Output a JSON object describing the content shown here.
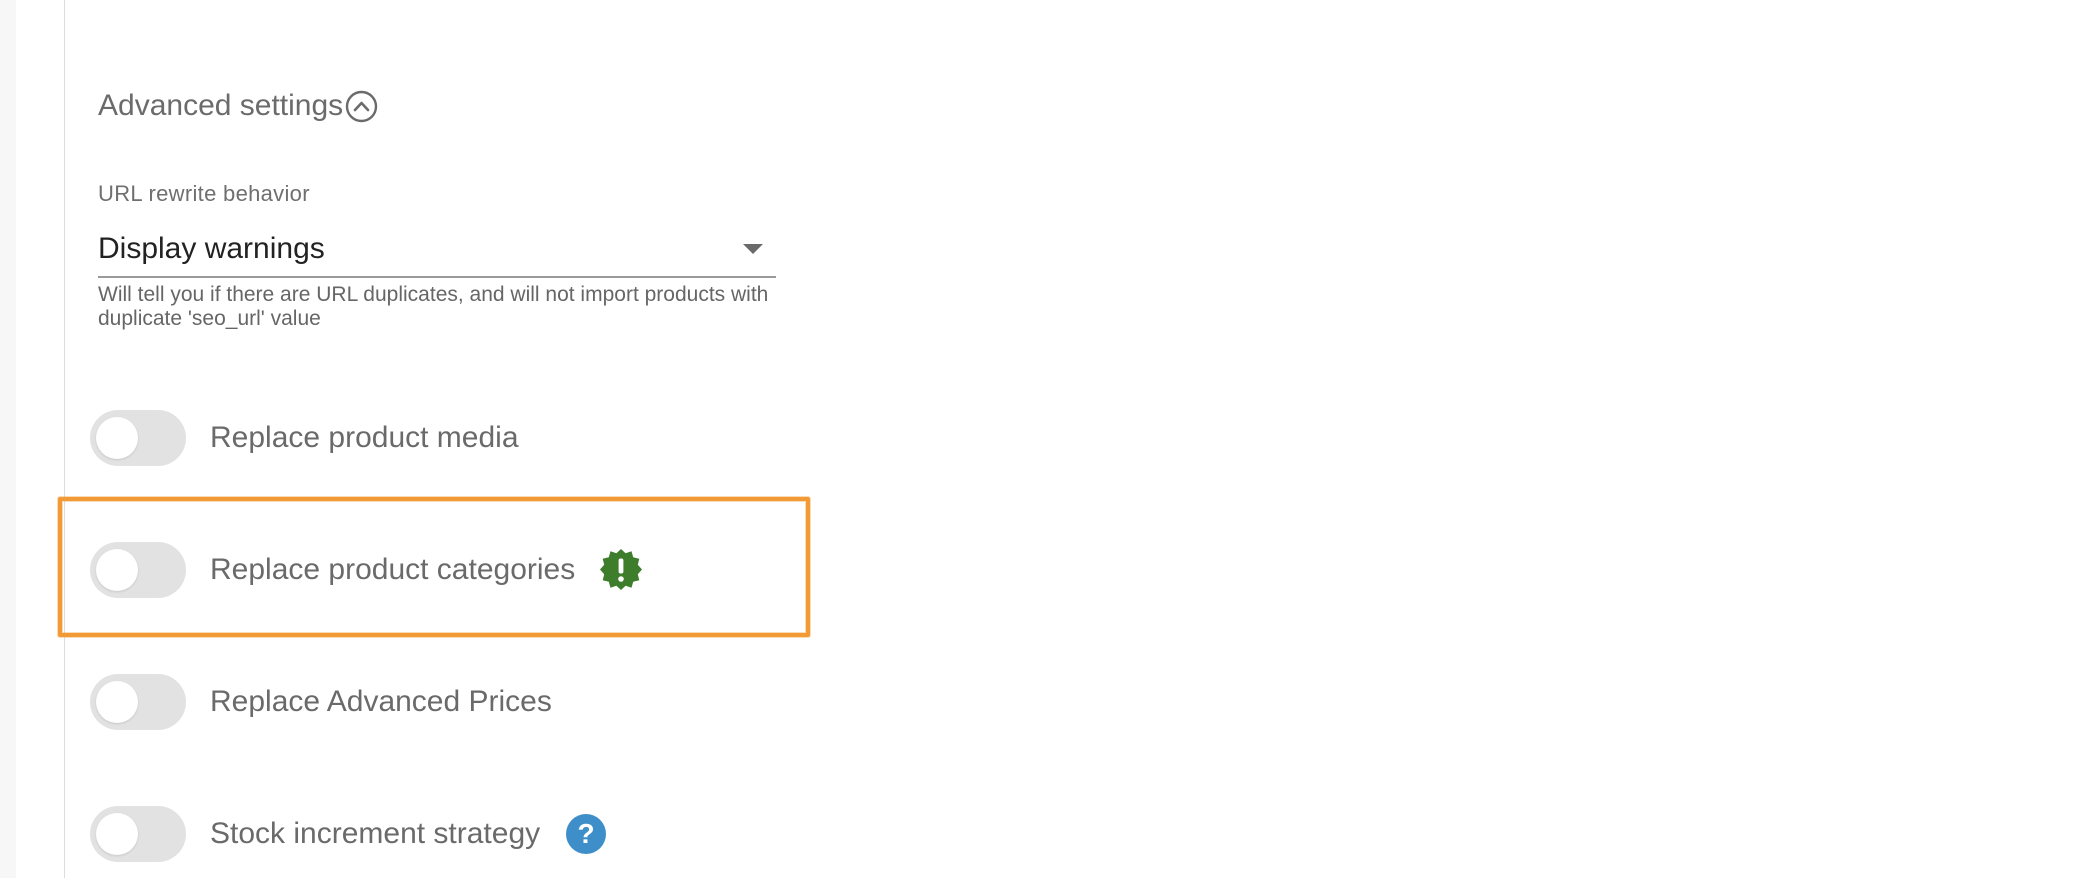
{
  "advanced_settings": {
    "title": "Advanced settings",
    "collapse_icon": "chevron-up-circle-icon"
  },
  "url_rewrite": {
    "label": "URL rewrite behavior",
    "selected_value": "Display warnings",
    "help_text": "Will tell you if there are URL duplicates, and will not import products with duplicate 'seo_url' value",
    "caret_icon": "chevron-down-icon"
  },
  "toggles": [
    {
      "label": "Replace product media",
      "checked": false
    },
    {
      "label": "Replace product categories",
      "checked": false,
      "icon": "warning-badge-icon"
    },
    {
      "label": "Replace Advanced Prices",
      "checked": false
    },
    {
      "label": "Stock increment strategy",
      "checked": false,
      "icon": "help-icon"
    }
  ],
  "colors": {
    "highlight": "#f19a36",
    "warning_badge": "#3d7d2c",
    "help_icon": "#3e8fc9",
    "toggle_off": "#e2e2e2",
    "text": "#6a6a6a"
  }
}
